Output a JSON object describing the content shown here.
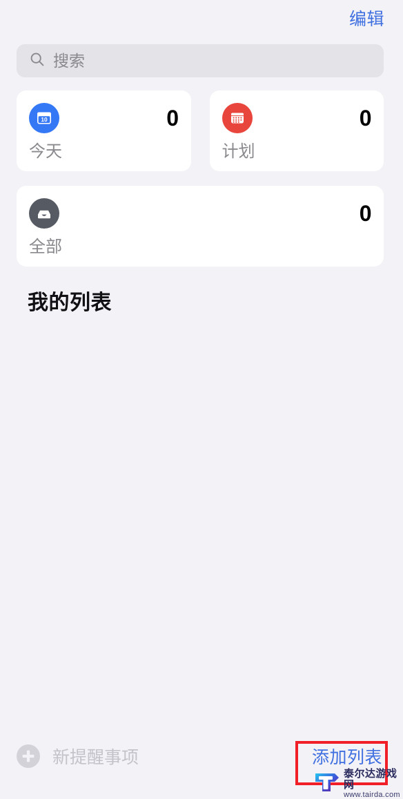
{
  "header": {
    "edit_label": "编辑"
  },
  "search": {
    "placeholder": "搜索",
    "value": "",
    "icon": "search-icon"
  },
  "smart_lists": [
    {
      "label": "今天",
      "count": "0",
      "icon": "calendar-day-icon",
      "badge_text": "10",
      "color": "#3478f6"
    },
    {
      "label": "计划",
      "count": "0",
      "icon": "calendar-grid-icon",
      "color": "#e8453c"
    },
    {
      "label": "全部",
      "count": "0",
      "icon": "inbox-tray-icon",
      "color": "#555a63"
    }
  ],
  "my_lists": {
    "title": "我的列表",
    "items": []
  },
  "bottom_bar": {
    "new_reminder_label": "新提醒事项",
    "new_reminder_icon": "plus-circle-icon",
    "add_list_label": "添加列表"
  },
  "annotation": {
    "highlight_color": "#f01f28",
    "target": "添加列表"
  },
  "watermark": {
    "title": "泰尔达游戏网",
    "url": "www.tairda.com"
  },
  "colors": {
    "background": "#f2f2f7",
    "card": "#ffffff",
    "accent_blue": "#4070e0",
    "muted_text": "#8a8a8e",
    "search_field": "#e3e3e8"
  }
}
